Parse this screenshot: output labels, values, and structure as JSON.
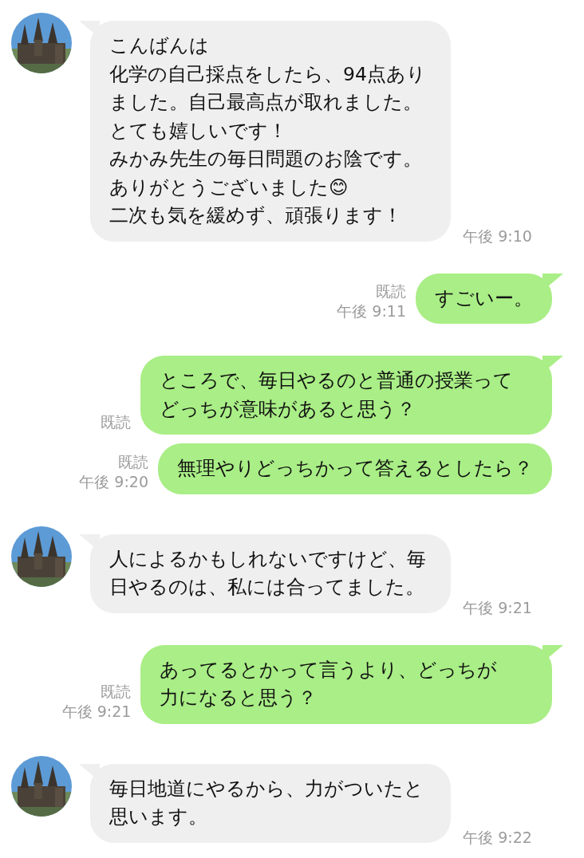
{
  "messages": [
    {
      "kind": "incoming",
      "tail": true,
      "paragraphs": [
        "こんばんは",
        "化学の自己採点をしたら、94点ありました。自己最高点が取れました。",
        "とても嬉しいです！",
        "みかみ先生の毎日問題のお陰です。",
        "ありがとうございました😊",
        "二次も気を緩めず、頑張ります！"
      ],
      "time": "午後 9:10"
    },
    {
      "kind": "outgoing",
      "tail": true,
      "text": "すごいー。",
      "read": "既読",
      "time": "午後 9:11"
    },
    {
      "kind": "outgoing",
      "tail": true,
      "text": "ところで、毎日やるのと普通の授業ってどっちが意味があると思う？",
      "read": "既読"
    },
    {
      "kind": "outgoing",
      "tail": false,
      "text": "無理やりどっちかって答えるとしたら？",
      "read": "既読",
      "time": "午後 9:20"
    },
    {
      "kind": "incoming",
      "tail": true,
      "text": "人によるかもしれないですけど、毎日やるのは、私には合ってました。",
      "time": "午後 9:21"
    },
    {
      "kind": "outgoing",
      "tail": true,
      "text": "あってるとかって言うより、どっちが力になると思う？",
      "read": "既読",
      "time": "午後 9:21"
    },
    {
      "kind": "incoming",
      "tail": true,
      "text": "毎日地道にやるから、力がついたと思います。",
      "time": "午後 9:22"
    }
  ]
}
